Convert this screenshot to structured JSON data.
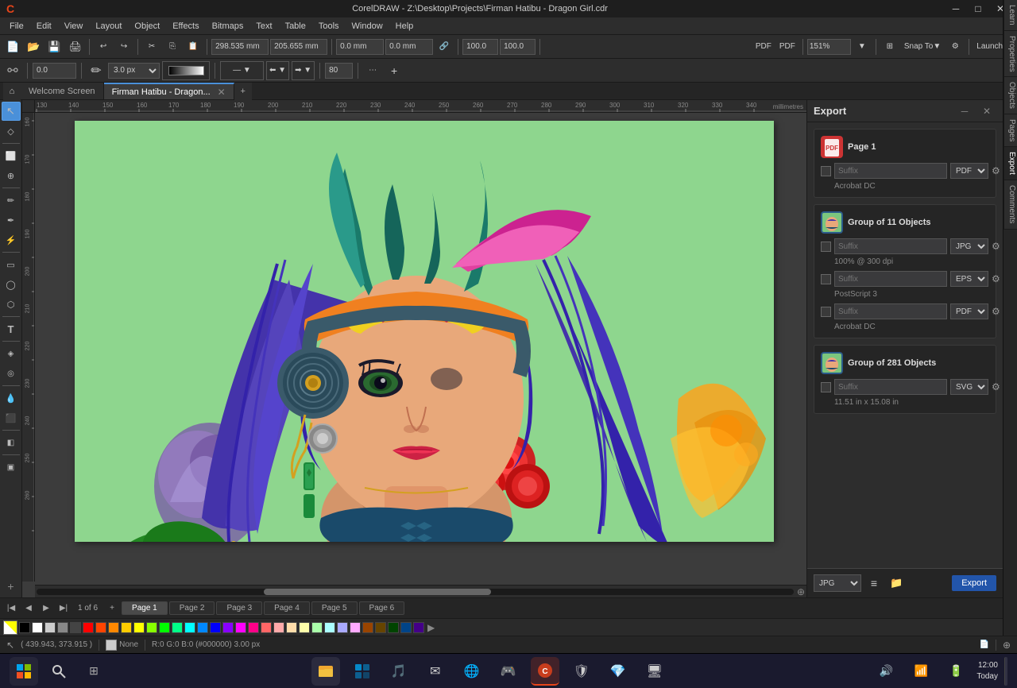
{
  "titlebar": {
    "title": "CorelDRAW - Z:\\Desktop\\Projects\\Firman Hatibu - Dragon Girl.cdr",
    "app_name": "CorelDRAW",
    "minimize": "─",
    "maximize": "□",
    "close": "✕",
    "logo": "●"
  },
  "menubar": {
    "items": [
      "File",
      "Edit",
      "View",
      "Layout",
      "Object",
      "Effects",
      "Bitmaps",
      "Text",
      "Table",
      "Tools",
      "Window",
      "Help"
    ]
  },
  "toolbar1": {
    "zoom_level": "151%",
    "snap_to": "Snap To",
    "launch": "Launch",
    "coords": {
      "x": "298.535 mm",
      "y": "205.655 mm",
      "w": "0.0 mm",
      "h": "0.0 mm",
      "w2": "100.0",
      "h2": "100.0"
    }
  },
  "toolbar2": {
    "stroke_size": "3.0 px",
    "value1": "0.0",
    "value2": "80"
  },
  "tabbar": {
    "home_icon": "⌂",
    "tabs": [
      {
        "id": "welcome",
        "label": "Welcome Screen",
        "active": false,
        "closable": false
      },
      {
        "id": "doc",
        "label": "Firman Hatibu - Dragon...",
        "active": true,
        "closable": true
      }
    ],
    "add_label": "+"
  },
  "toolbox": {
    "tools": [
      {
        "id": "select",
        "icon": "↖",
        "label": "Select Tool",
        "active": true
      },
      {
        "id": "shape",
        "icon": "◇",
        "label": "Shape Tool",
        "active": false
      },
      {
        "id": "crop",
        "icon": "⬜",
        "label": "Crop Tool",
        "active": false
      },
      {
        "id": "zoom",
        "icon": "🔍",
        "label": "Zoom Tool",
        "active": false
      },
      {
        "id": "freehand",
        "icon": "✏",
        "label": "Freehand Tool",
        "active": false
      },
      {
        "id": "smart",
        "icon": "⚡",
        "label": "Smart Drawing Tool",
        "active": false
      },
      {
        "id": "rect",
        "icon": "▭",
        "label": "Rectangle Tool",
        "active": false
      },
      {
        "id": "ellipse",
        "icon": "◯",
        "label": "Ellipse Tool",
        "active": false
      },
      {
        "id": "polygon",
        "icon": "⬡",
        "label": "Polygon Tool",
        "active": false
      },
      {
        "id": "text",
        "icon": "T",
        "label": "Text Tool",
        "active": false
      },
      {
        "id": "parallel",
        "icon": "∥",
        "label": "Parallel Dimension Tool",
        "active": false
      },
      {
        "id": "connector",
        "icon": "⤢",
        "label": "Connector Tool",
        "active": false
      },
      {
        "id": "blend",
        "icon": "◈",
        "label": "Blend Tool",
        "active": false
      },
      {
        "id": "eyedropper",
        "icon": "💧",
        "label": "Eyedropper Tool",
        "active": false
      },
      {
        "id": "interactive",
        "icon": "⬛",
        "label": "Interactive Fill Tool",
        "active": false
      },
      {
        "id": "smart2",
        "icon": "◧",
        "label": "Smart Fill Tool",
        "active": false
      },
      {
        "id": "color",
        "icon": "▣",
        "label": "Color",
        "active": false
      }
    ]
  },
  "canvas": {
    "ruler_unit": "millimetres",
    "background_color": "#7bc67e",
    "doc_shadow": true
  },
  "right_panel": {
    "title": "Export",
    "close_icon": "✕",
    "minimize_icon": "─",
    "side_tabs": [
      "Learn",
      "Properties",
      "Objects",
      "Pages",
      "Export",
      "Comments"
    ],
    "active_side_tab": "Export",
    "export_button_label": "Export",
    "items": [
      {
        "id": "page1",
        "type": "page",
        "title": "Page 1",
        "rows": [
          {
            "checked": false,
            "suffix": "Suffix",
            "format": "PDF",
            "subtitle": "Acrobat DC"
          }
        ]
      },
      {
        "id": "group11",
        "type": "group",
        "title": "Group of 11 Objects",
        "rows": [
          {
            "checked": false,
            "suffix": "Suffix",
            "format": "JPG",
            "subtitle": "100% @ 300 dpi"
          },
          {
            "checked": false,
            "suffix": "Suffix",
            "format": "EPS",
            "subtitle": "PostScript 3"
          },
          {
            "checked": false,
            "suffix": "Suffix",
            "format": "PDF",
            "subtitle": "Acrobat DC"
          }
        ]
      },
      {
        "id": "group281",
        "type": "group",
        "title": "Group of 281 Objects",
        "rows": [
          {
            "checked": false,
            "suffix": "Suffix",
            "format": "SVG",
            "subtitle": "11.51 in x 15.08 in"
          }
        ]
      }
    ],
    "add_icon": "+",
    "jpg_dropdown": "JPG",
    "folder_icon": "📁"
  },
  "pagetabs": {
    "prev_icon": "◀",
    "first_icon": "|◀",
    "next_icon": "▶",
    "last_icon": "▶|",
    "add_icon": "+",
    "indicator": "1 of 6",
    "pages": [
      "Page 1",
      "Page 2",
      "Page 3",
      "Page 4",
      "Page 5",
      "Page 6"
    ],
    "active_page": "Page 1"
  },
  "colorbar": {
    "colors": [
      "#000000",
      "#ffffff",
      "#cccccc",
      "#888888",
      "#444444",
      "#ff0000",
      "#ff4400",
      "#ff8800",
      "#ffcc00",
      "#ffff00",
      "#88ff00",
      "#00ff00",
      "#00ff88",
      "#00ffff",
      "#0088ff",
      "#0000ff",
      "#8800ff",
      "#ff00ff",
      "#ff0088",
      "#ff6666",
      "#ffaaaa",
      "#ffddaa",
      "#ffffaa",
      "#aaffaa",
      "#aaffff",
      "#aaaaff",
      "#ffaaff",
      "#994400",
      "#664400",
      "#004400",
      "#004488",
      "#440088"
    ],
    "arrow_left": "◀",
    "arrow_right": "▶"
  },
  "statusbar": {
    "coordinates": "( 439.943, 373.915 )",
    "fill_icon": "◆",
    "fill_label": "None",
    "stroke_info": "R:0 G:0 B:0 (#000000) 3.00 px",
    "page_info": "Page 1",
    "zoom_icon": "🔍"
  },
  "taskbar": {
    "start_icon": "⊞",
    "search_icon": "🔍",
    "apps": [
      "📁",
      "⊞",
      "🎵",
      "📧",
      "🌐",
      "🎮",
      "🛡",
      "💻"
    ],
    "time": "12:00",
    "date": "Today",
    "tray_icons": [
      "🔊",
      "📶",
      "🔋"
    ]
  }
}
